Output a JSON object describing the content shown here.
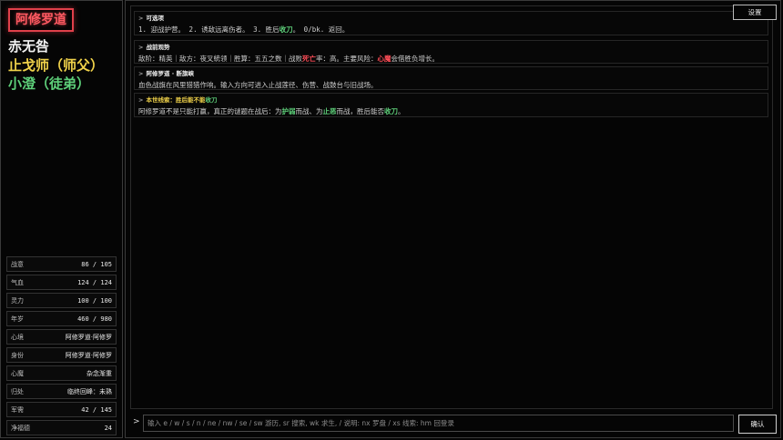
{
  "sidebar": {
    "title": "阿修罗道",
    "characters": [
      "赤无咎",
      "止戈师（师父）",
      "小澄（徒弟）"
    ],
    "stats": [
      {
        "label": "战意",
        "value": "86 / 105"
      },
      {
        "label": "气血",
        "value": "124 / 124"
      },
      {
        "label": "灵力",
        "value": "100 / 100"
      },
      {
        "label": "年岁",
        "value": "460 / 980"
      },
      {
        "label": "心境",
        "value": "阿修罗道·阿修罗"
      },
      {
        "label": "身份",
        "value": "阿修罗道·阿修罗"
      },
      {
        "label": "心魔",
        "value": "杂念渐重"
      },
      {
        "label": "归处",
        "value": "临终回峰：未熟"
      },
      {
        "label": "军需",
        "value": "42 / 145"
      },
      {
        "label": "净福德",
        "value": "24"
      }
    ]
  },
  "header": {
    "settings_label": "设置"
  },
  "log": {
    "cards": [
      {
        "title": "可选项",
        "body": {
          "p1": "1. 迎战护营。 2. 诱敌远离伤者。 3. 胜后",
          "h1": "收刀",
          "p2": "。 0/bk. 返回。"
        }
      },
      {
        "title": "战前观势",
        "body": {
          "p1": "敌阶：精英｜敌方：夜叉統领｜胜算：五五之数｜战败",
          "h1": "死亡",
          "p2": "率：高。主要风险：",
          "h2": "心魔",
          "p3": "会借胜负增长。"
        }
      },
      {
        "title": "阿修罗道 · 断旗峡",
        "body": {
          "p1": "血色战旗在风里猎猎作响。输入方向可进入止战莲径、伤营、战鼓台与旧战场。"
        }
      },
      {
        "title_main": "本世线索：胜后能不能",
        "title_hl": "收刀",
        "body": {
          "p1": "阿修罗道不是只能打赢，真正的谜题在战后：为",
          "h1": "护弱",
          "p2": "而战、为",
          "h2": "止恶",
          "p3": "而战，胜后能否",
          "h3": "收刀",
          "p4": "。"
        }
      }
    ]
  },
  "command": {
    "prompt": ">",
    "placeholder": "输入 e / w / s / n / ne / nw / se / sw 游历, sr 搜索, wk 求生, / 说明: nx 罗盘 / xs 线索: hm 回登录",
    "value": "",
    "confirm_label": "确认"
  },
  "colors": {
    "title_red": "#ff5a62",
    "master_yellow": "#f0d24a",
    "disciple_green": "#5ed07a",
    "danger_red": "#ff4d57",
    "clue_blue": "#4a9bff"
  }
}
